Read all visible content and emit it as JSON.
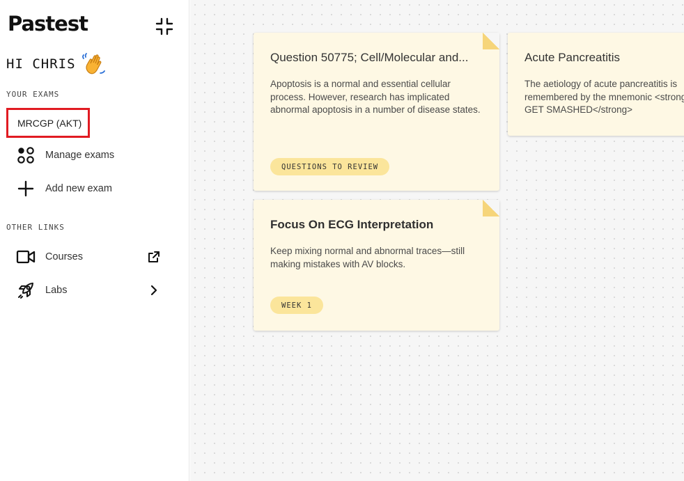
{
  "app": {
    "logo_left": "Pas",
    "logo_highlight": "test"
  },
  "sidebar": {
    "greeting": "HI CHRIS",
    "your_exams_label": "YOUR EXAMS",
    "active_exam": "MRCGP (AKT)",
    "exam_actions": [
      {
        "label": "Manage exams",
        "icon": "dots-grid-icon"
      },
      {
        "label": "Add new exam",
        "icon": "plus-icon"
      }
    ],
    "other_links_label": "OTHER LINKS",
    "other_links": [
      {
        "label": "Courses",
        "icon": "video-icon",
        "trail": "external-link-icon"
      },
      {
        "label": "Labs",
        "icon": "rocket-icon",
        "trail": "chevron-right-icon"
      }
    ]
  },
  "notes": [
    {
      "title": "Question 50775; Cell/Molecular and...",
      "body": "Apoptosis is a normal and essential cellular process. However, research has implicated abnormal apoptosis in a number of disease states.",
      "tag": "QUESTIONS TO REVIEW"
    },
    {
      "title": "Acute Pancreatitis",
      "body": "The aetiology of acute pancreatitis is remembered by the mnemonic <strong>I GET SMASHED</strong>"
    },
    {
      "title": "Focus On ECG Interpretation",
      "body": "Keep mixing normal and abnormal traces—still making mistakes with AV blocks.",
      "tag": "WEEK 1"
    }
  ],
  "colors": {
    "accent_green": "#3ecf7a",
    "selection_red": "#e11b22",
    "note_bg": "#fef8e4",
    "tag_bg": "#fbe59b",
    "fold": "#f6d57a"
  }
}
